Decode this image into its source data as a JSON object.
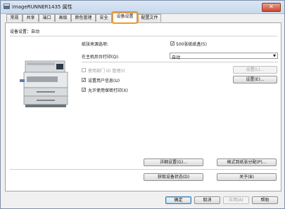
{
  "window": {
    "title": "imageRUNNER1435 属性",
    "close_glyph": "✕"
  },
  "tabs": [
    {
      "label": "常规"
    },
    {
      "label": "共享"
    },
    {
      "label": "端口"
    },
    {
      "label": "高级"
    },
    {
      "label": "颜色管理"
    },
    {
      "label": "安全"
    },
    {
      "label": "设备设置"
    },
    {
      "label": "配置文件"
    }
  ],
  "active_tab": "设备设置",
  "device_settings": {
    "header": "设备设置：自动",
    "paper_source_label": "纸张来源选项:",
    "paper_source_checkbox": {
      "label": "500张纸纸盒(5)",
      "checked": true
    },
    "print_host_label": "在主机后台打印(Q):",
    "print_host_value": "自动",
    "dept_id": {
      "label": "使用部门 ID 管理(I)",
      "checked": false,
      "settings_label": "设置(L)...",
      "settings_disabled": true
    },
    "user_info": {
      "label": "设置用户信息(U)",
      "checked": true,
      "settings_label": "设置(E)..."
    },
    "secure_print": {
      "label": "允许使用保密打印(X)",
      "checked": true
    },
    "details_button": "详细设置(G)...",
    "paper_size_button": "格式到纸张分配(P)...",
    "get_status_button": "获取设备状态(D)",
    "about_button": "关于(B)"
  },
  "footer": {
    "ok": "确定",
    "cancel": "取消",
    "apply": "应用(A)",
    "help": "帮助"
  },
  "check_glyph": "✓",
  "dropdown_glyph": "▼"
}
